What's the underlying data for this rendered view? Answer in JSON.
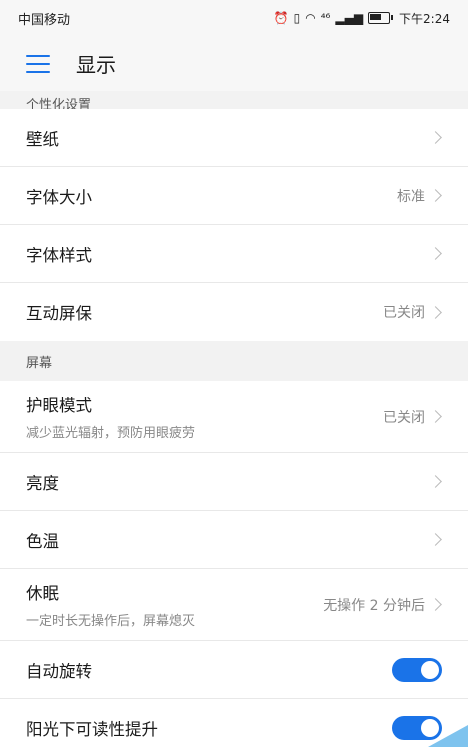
{
  "status_bar": {
    "carrier": "中国移动",
    "signal_label": "⁴⁶",
    "time": "下午2:24",
    "icons": [
      "alarm-icon",
      "vibrate-icon",
      "wifi-icon",
      "cellular-signal-icon",
      "battery-icon"
    ],
    "battery_level": 0.6
  },
  "app_bar": {
    "title": "显示",
    "menu_icon": "hamburger-menu-icon",
    "accent_color": "#1a73e8"
  },
  "sections": {
    "personalization": {
      "header": "个性化设置",
      "items": [
        {
          "label": "壁纸",
          "value": ""
        },
        {
          "label": "字体大小",
          "value": "标准"
        },
        {
          "label": "字体样式",
          "value": ""
        },
        {
          "label": "互动屏保",
          "value": "已关闭"
        }
      ]
    },
    "screen": {
      "header": "屏幕",
      "items": [
        {
          "label": "护眼模式",
          "subtitle": "减少蓝光辐射，预防用眼疲劳",
          "value": "已关闭"
        },
        {
          "label": "亮度",
          "value": ""
        },
        {
          "label": "色温",
          "value": ""
        },
        {
          "label": "休眠",
          "subtitle": "一定时长无操作后，屏幕熄灭",
          "value": "无操作 2 分钟后"
        },
        {
          "label": "自动旋转",
          "toggle_on": true
        },
        {
          "label": "阳光下可读性提升",
          "toggle_on": true
        }
      ]
    }
  }
}
